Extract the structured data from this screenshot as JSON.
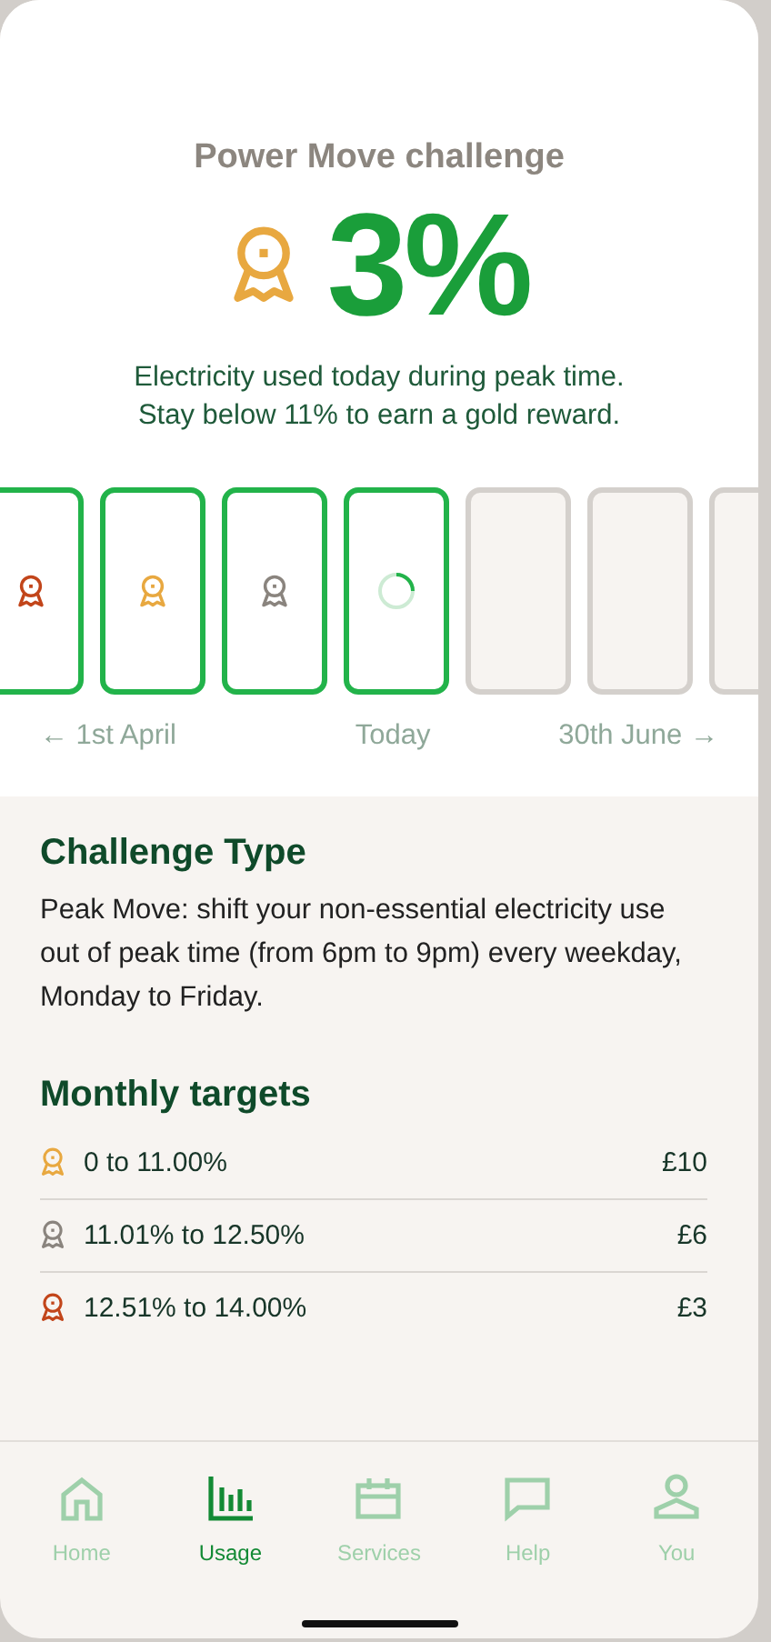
{
  "challenge": {
    "title": "Power Move challenge",
    "percent": "3%",
    "description": "Electricity used today during peak time.\nStay below 11% to earn a gold reward."
  },
  "days": [
    {
      "kind": "medal",
      "color": "#c2451a"
    },
    {
      "kind": "medal",
      "color": "#e8a840"
    },
    {
      "kind": "medal",
      "color": "#8a847e"
    },
    {
      "kind": "progress"
    },
    {
      "kind": "empty"
    },
    {
      "kind": "empty"
    },
    {
      "kind": "empty"
    }
  ],
  "timeline": {
    "start": "← 1st April",
    "today": "Today",
    "end": "30th June →"
  },
  "challenge_type": {
    "heading": "Challenge Type",
    "text": "Peak Move: shift your non-essential electricity use out of peak time (from 6pm to 9pm) every weekday, Monday to Friday."
  },
  "monthly_targets": {
    "heading": "Monthly targets",
    "rows": [
      {
        "color": "#e8a840",
        "range": "0 to 11.00%",
        "reward": "£10"
      },
      {
        "color": "#8a847e",
        "range": "11.01% to 12.50%",
        "reward": "£6"
      },
      {
        "color": "#c2451a",
        "range": "12.51% to 14.00%",
        "reward": "£3"
      }
    ]
  },
  "nav": [
    {
      "label": "Home",
      "selected": false
    },
    {
      "label": "Usage",
      "selected": true
    },
    {
      "label": "Services",
      "selected": false
    },
    {
      "label": "Help",
      "selected": false
    },
    {
      "label": "You",
      "selected": false
    }
  ]
}
